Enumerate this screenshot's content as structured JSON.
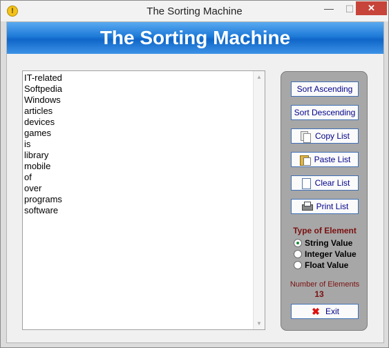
{
  "window": {
    "title": "The Sorting Machine"
  },
  "banner": {
    "title": "The Sorting Machine"
  },
  "list": {
    "items": [
      "IT-related",
      "Softpedia",
      "Windows",
      "articles",
      "devices",
      "games",
      "is",
      "library",
      "mobile",
      "of",
      "over",
      "programs",
      "software"
    ]
  },
  "buttons": {
    "sort_ascending": "Sort Ascending",
    "sort_descending": "Sort Descending",
    "copy_list": "Copy List",
    "paste_list": "Paste List",
    "clear_list": "Clear List",
    "print_list": "Print List",
    "exit": "Exit"
  },
  "element_type": {
    "title": "Type of Element",
    "options": [
      "String Value",
      "Integer Value",
      "Float Value"
    ],
    "selected": "String Value"
  },
  "count": {
    "label": "Number of Elements",
    "value": "13"
  },
  "colors": {
    "banner": "#1e7ad8",
    "panel": "#a7a7a7",
    "accent_text": "#7b1010",
    "close_button": "#c7443a"
  }
}
